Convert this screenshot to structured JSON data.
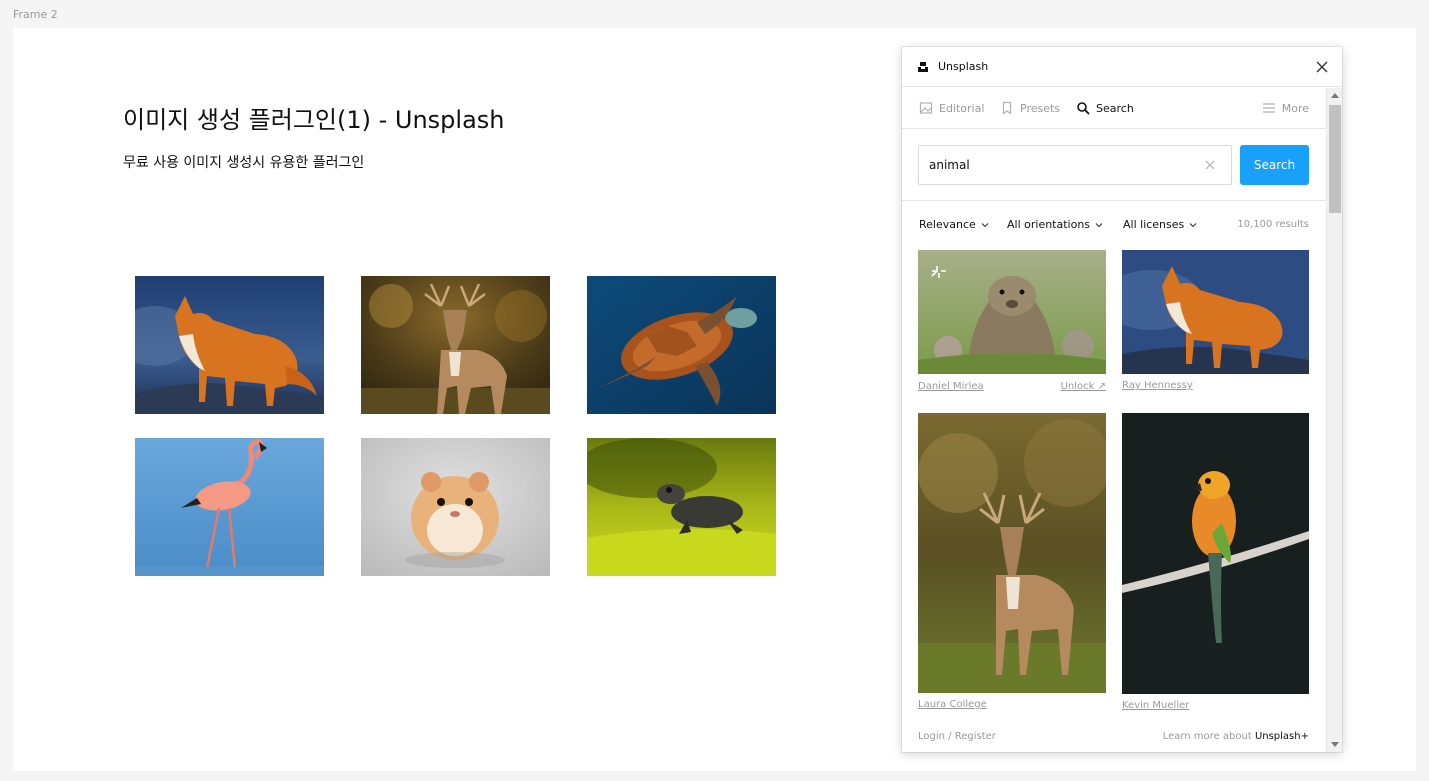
{
  "canvas": {
    "frame_label": "Frame 2",
    "title": "이미지 생성 플러그인(1) - Unsplash",
    "subtitle": "무료 사용 이미지 생성시 유용한 플러그인",
    "photos": [
      "fox",
      "deer",
      "sea-turtle",
      "flamingo",
      "hamster",
      "toad"
    ]
  },
  "plugin": {
    "title": "Unsplash",
    "tabs": [
      {
        "label": "Editorial",
        "icon": "image-icon",
        "active": false
      },
      {
        "label": "Presets",
        "icon": "bookmark-icon",
        "active": false
      },
      {
        "label": "Search",
        "icon": "search-icon",
        "active": true
      },
      {
        "label": "More",
        "icon": "menu-icon",
        "active": false
      }
    ],
    "search": {
      "value": "animal",
      "button_label": "Search"
    },
    "filters": {
      "relevance": "Relevance",
      "orientation": "All orientations",
      "license": "All licenses",
      "results_count": "10,100 results"
    },
    "results": [
      {
        "credit": "Daniel Mirlea",
        "subject": "marmot",
        "plus": true,
        "unlock_label": "Unlock ↗"
      },
      {
        "credit": "Ray Hennessy",
        "subject": "fox"
      },
      {
        "credit": "Laura College",
        "subject": "deer"
      },
      {
        "credit": "Kevin Mueller",
        "subject": "parrot"
      }
    ],
    "footer": {
      "login": "Login / Register",
      "learn_prefix": "Learn more about ",
      "learn_link": "Unsplash+"
    }
  },
  "colors": {
    "accent": "#18a0fb",
    "muted": "#9a9a9a",
    "canvas_bg": "#f5f5f5"
  }
}
